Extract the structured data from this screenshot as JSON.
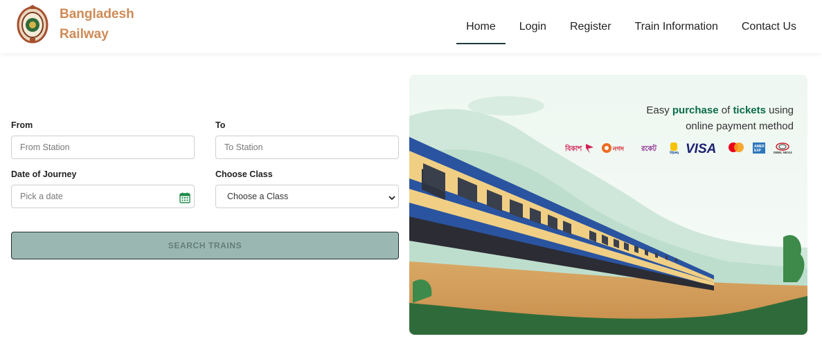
{
  "brand": {
    "line1": "Bangladesh",
    "line2": "Railway"
  },
  "nav": {
    "items": [
      {
        "label": "Home",
        "active": true
      },
      {
        "label": "Login",
        "active": false
      },
      {
        "label": "Register",
        "active": false
      },
      {
        "label": "Train Information",
        "active": false
      },
      {
        "label": "Contact Us",
        "active": false
      }
    ]
  },
  "form": {
    "from": {
      "label": "From",
      "placeholder": "From Station"
    },
    "to": {
      "label": "To",
      "placeholder": "To Station"
    },
    "date": {
      "label": "Date of Journey",
      "placeholder": "Pick a date"
    },
    "class": {
      "label": "Choose Class",
      "selected": "Choose a Class"
    },
    "search_label": "SEARCH TRAINS"
  },
  "banner": {
    "promo_prefix": "Easy",
    "promo_word1": "purchase",
    "promo_mid": "of",
    "promo_word2": "tickets",
    "promo_suffix": "using",
    "promo_line2": "online payment method",
    "payment_methods": [
      "bkash",
      "nagad",
      "rocket",
      "upay",
      "VISA",
      "mastercard",
      "amex",
      "DBBL NEXUS"
    ]
  },
  "colors": {
    "brand": "#cf8a55",
    "accent": "#0b6b4b",
    "button": "#9ab8b1",
    "nav_underline": "#1f3a3a"
  }
}
